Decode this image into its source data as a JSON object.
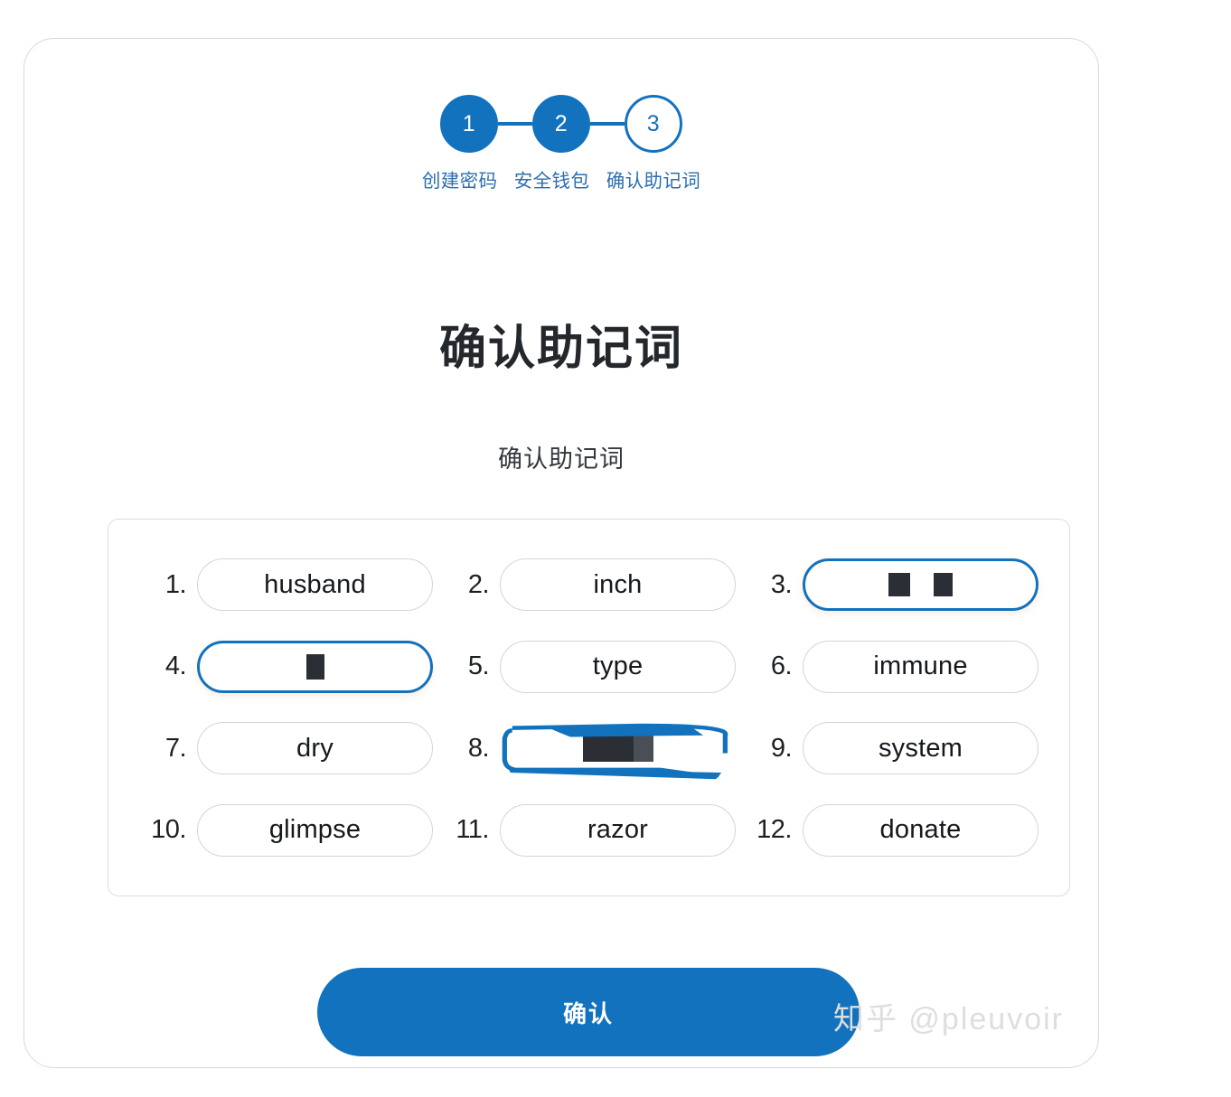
{
  "colors": {
    "accent": "#1272BE",
    "card_border": "#d6d8db",
    "pill_border": "#d3d5d8",
    "text_dark": "#15181c",
    "redaction": "#2b2f35",
    "watermark": "#dcdee0"
  },
  "stepper": {
    "steps": [
      {
        "number": "1",
        "label": "创建密码",
        "state": "done"
      },
      {
        "number": "2",
        "label": "安全钱包",
        "state": "done"
      },
      {
        "number": "3",
        "label": "确认助记词",
        "state": "current"
      }
    ]
  },
  "page": {
    "title": "确认助记词",
    "subtitle": "确认助记词"
  },
  "mnemonic": {
    "words": [
      {
        "index": "1.",
        "word": "husband",
        "selected": false,
        "redacted": false
      },
      {
        "index": "2.",
        "word": "inch",
        "selected": false,
        "redacted": false
      },
      {
        "index": "3.",
        "word": "",
        "selected": true,
        "redacted": true
      },
      {
        "index": "4.",
        "word": "",
        "selected": true,
        "redacted": true
      },
      {
        "index": "5.",
        "word": "type",
        "selected": false,
        "redacted": false
      },
      {
        "index": "6.",
        "word": "immune",
        "selected": false,
        "redacted": false
      },
      {
        "index": "7.",
        "word": "dry",
        "selected": false,
        "redacted": false
      },
      {
        "index": "8.",
        "word": "",
        "selected": true,
        "redacted": true
      },
      {
        "index": "9.",
        "word": "system",
        "selected": false,
        "redacted": false
      },
      {
        "index": "10.",
        "word": "glimpse",
        "selected": false,
        "redacted": false
      },
      {
        "index": "11.",
        "word": "razor",
        "selected": false,
        "redacted": false
      },
      {
        "index": "12.",
        "word": "donate",
        "selected": false,
        "redacted": false
      }
    ]
  },
  "actions": {
    "confirm_label": "确认"
  },
  "watermark": {
    "text": "知乎 @pleuvoir"
  }
}
